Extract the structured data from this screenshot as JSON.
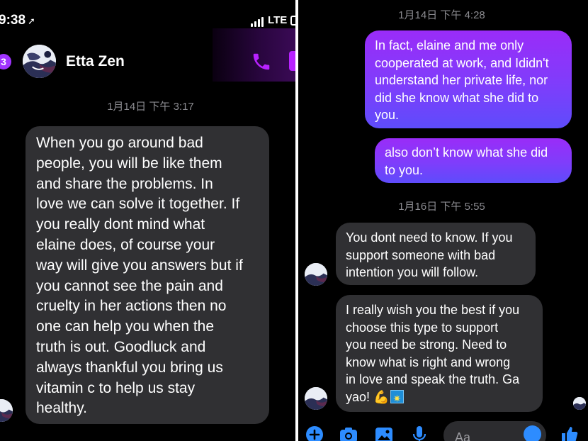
{
  "left_screen": {
    "status_bar": {
      "time": "9:38",
      "location_arrow": "➚",
      "network": "LTE"
    },
    "header": {
      "unread_count": "3",
      "contact_name": "Etta Zen"
    },
    "timestamp": "1月14日 下午 3:17",
    "message": "When you go around bad\npeople, you will be like them\nand share the problems. In\nlove we can solve it together. If\nyou really dont mind what\nelaine does, of course your\nway will give you answers but if\nyou cannot see the pain and\ncruelty in her actions then no\none can help you when the\ntruth is out. Goodluck and\nalways thankful you bring us\nvitamin c to help us stay\nhealthy."
  },
  "right_screen": {
    "timestamp_1": "1月14日 下午 4:28",
    "outgoing_1": "In fact, elaine and me only\ncooperated at work, and Ididn't\nunderstand her private life, nor\ndid she know what she did to\nyou.",
    "outgoing_2": "also don’t know what she did\nto you.",
    "timestamp_2": "1月16日 下午 5:55",
    "incoming_1": "You dont need to know. If you\nsupport someone with bad\nintention you will follow.",
    "incoming_2": "I really wish you the best if you\nchoose this type to support\nyou need be strong. Need to\nknow what is right and wrong\nin love and speak the truth. Ga\nyao! ",
    "incoming_2_emojis": [
      "flexed-biceps-icon",
      "sparkle-icon"
    ],
    "composer": {
      "placeholder": "Aa"
    },
    "toolbar_icons": [
      "plus-icon",
      "camera-icon",
      "image-icon",
      "microphone-icon",
      "emoji-icon",
      "thumbs-up-icon"
    ]
  },
  "colors": {
    "background": "#000000",
    "incoming_bubble": "#303033",
    "outgoing_top": "#9a2cf8",
    "outgoing_bottom": "#5e4cfb",
    "accent": "#b822ff",
    "toolbar_blue": "#2d8cff",
    "timestamp": "#8b8b90"
  }
}
